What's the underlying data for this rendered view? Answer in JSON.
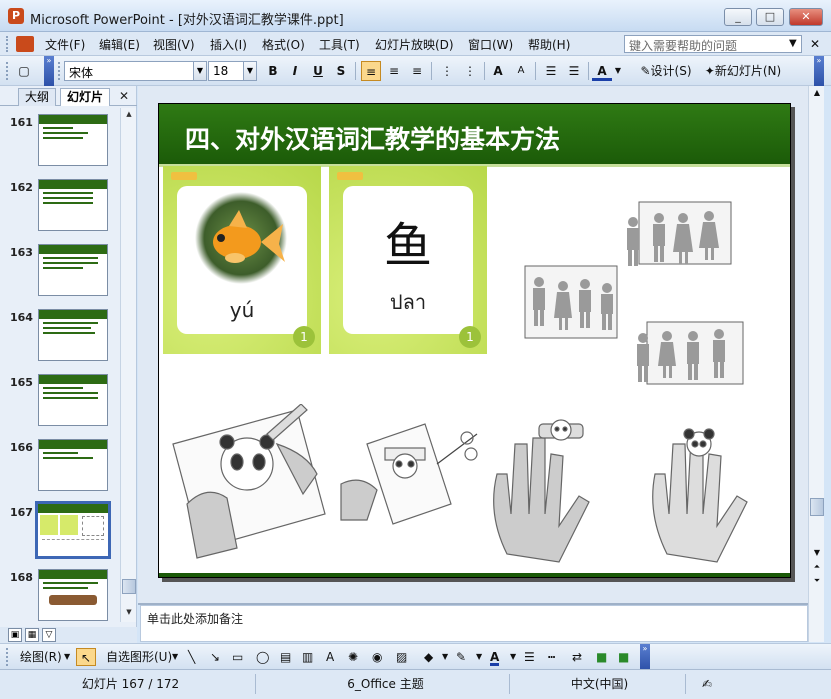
{
  "window": {
    "title": "Microsoft PowerPoint - [对外汉语词汇教学课件.ppt]",
    "controls": [
      "_",
      "□",
      "✕"
    ]
  },
  "menubar": {
    "items": [
      "文件(F)",
      "编辑(E)",
      "视图(V)",
      "插入(I)",
      "格式(O)",
      "工具(T)",
      "幻灯片放映(D)",
      "窗口(W)",
      "帮助(H)"
    ],
    "help_placeholder": "键入需要帮助的问题",
    "close": "✕"
  },
  "toolbar": {
    "font": "宋体",
    "size": "18",
    "bold": "B",
    "italic": "I",
    "underline": "U",
    "shadow": "S",
    "design": "设计(S)",
    "new_slide": "新幻灯片(N)"
  },
  "leftpane": {
    "tab_outline": "大纲",
    "tab_slides": "幻灯片",
    "close": "✕",
    "thumbs": [
      {
        "num": "161"
      },
      {
        "num": "162"
      },
      {
        "num": "163"
      },
      {
        "num": "164"
      },
      {
        "num": "165"
      },
      {
        "num": "166"
      },
      {
        "num": "167"
      },
      {
        "num": "168"
      }
    ]
  },
  "slide": {
    "title": "四、对外汉语词汇教学的基本方法",
    "card1_pinyin": "yú",
    "card2_hanzi": "鱼",
    "card2_thai": "ปลา",
    "card_number": "1"
  },
  "notes": {
    "placeholder": "单击此处添加备注"
  },
  "drawbar": {
    "draw": "绘图(R)",
    "autoshapes": "自选图形(U)"
  },
  "status": {
    "slide": "幻灯片 167 / 172",
    "theme": "6_Office 主题",
    "language": "中文(中国)"
  }
}
